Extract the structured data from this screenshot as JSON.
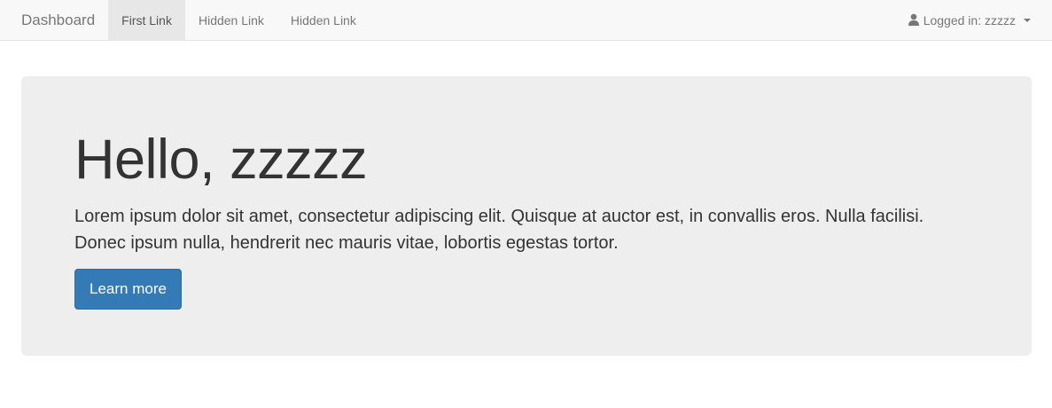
{
  "navbar": {
    "brand": "Dashboard",
    "links": [
      {
        "label": "First Link",
        "active": true
      },
      {
        "label": "Hidden Link",
        "active": false
      },
      {
        "label": "Hidden Link",
        "active": false
      }
    ],
    "user_menu": {
      "icon": "user-icon",
      "label": "Logged in: zzzzz"
    }
  },
  "jumbotron": {
    "heading": "Hello, zzzzz",
    "text": "Lorem ipsum dolor sit amet, consectetur adipiscing elit. Quisque at auctor est, in convallis eros. Nulla facilisi. Donec ipsum nulla, hendrerit nec mauris vitae, lobortis egestas tortor.",
    "button_label": "Learn more"
  },
  "colors": {
    "navbar_bg": "#f8f8f8",
    "jumbotron_bg": "#eeeeee",
    "primary": "#337ab7"
  }
}
